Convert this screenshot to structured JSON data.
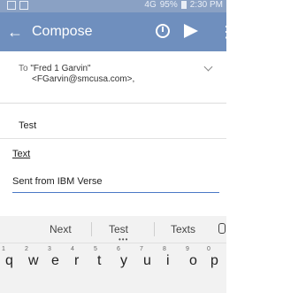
{
  "statusbar": {
    "network": "4G",
    "signal": "95%",
    "time": "2:30 PM"
  },
  "appbar": {
    "back_icon": "←",
    "title": "Compose",
    "more_icon": "⋮"
  },
  "to": {
    "label": "To",
    "name": "\"Fred 1 Garvin\"",
    "email": "<FGarvin@smcusa.com>,"
  },
  "subject": "Test",
  "format_label": "Text",
  "body": "Sent from IBM Verse",
  "keyboard": {
    "suggestions": [
      "Next",
      "Test",
      "Texts"
    ],
    "keys": [
      {
        "num": "1",
        "letter": "q"
      },
      {
        "num": "2",
        "letter": "w"
      },
      {
        "num": "3",
        "letter": "e"
      },
      {
        "num": "4",
        "letter": "r"
      },
      {
        "num": "5",
        "letter": "t"
      },
      {
        "num": "6",
        "letter": "y"
      },
      {
        "num": "7",
        "letter": "u"
      },
      {
        "num": "8",
        "letter": "i"
      },
      {
        "num": "9",
        "letter": "o"
      },
      {
        "num": "0",
        "letter": "p"
      }
    ]
  }
}
